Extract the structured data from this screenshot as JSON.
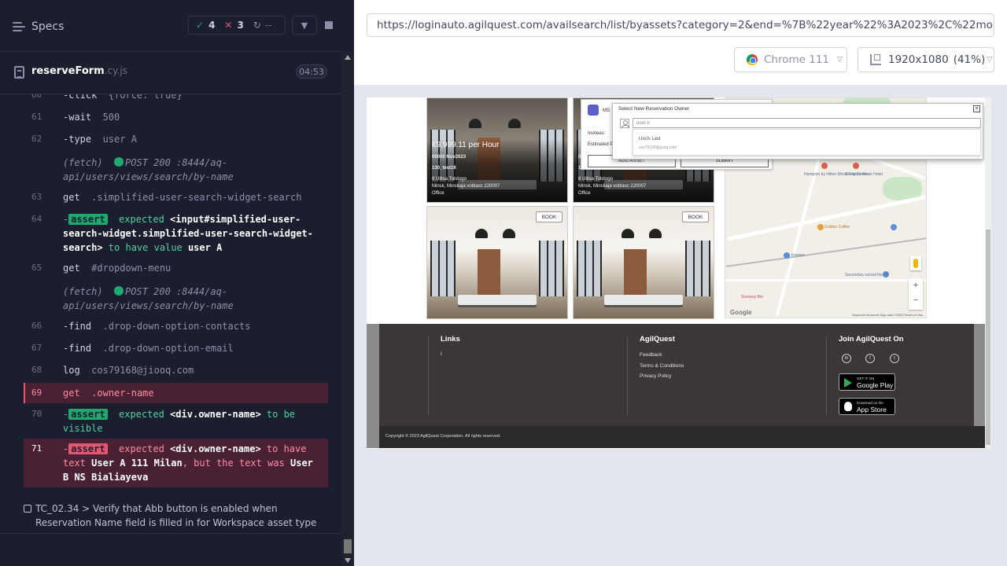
{
  "header": {
    "title": "Specs",
    "stats": {
      "passed": "4",
      "failed": "3",
      "pending": "--"
    }
  },
  "spec_file": {
    "name": "reserveForm",
    "ext": ".cy.js",
    "duration": "04:53"
  },
  "commands": [
    {
      "num": "60",
      "name": "-click",
      "message": "{force: true}"
    },
    {
      "num": "61",
      "name": "-wait",
      "message": "500"
    },
    {
      "num": "62",
      "name": "-type",
      "message": "user A"
    },
    {
      "num": "",
      "fetch_label": "(fetch)",
      "fetch_text": "POST 200 :8444/aq-api/users/views/search/by-name"
    },
    {
      "num": "63",
      "name": "get",
      "message": ".simplified-user-search-widget-search"
    },
    {
      "num": "64",
      "dash": "-",
      "badge": "assert",
      "pre": "expected ",
      "strong1": "<input#simplified-user-search-widget.simplified-user-search-widget-search>",
      "mid": " to have value ",
      "strong2": "user A"
    },
    {
      "num": "65",
      "name": "get",
      "message": "#dropdown-menu"
    },
    {
      "num": "",
      "fetch_label": "(fetch)",
      "fetch_text": "POST 200 :8444/aq-api/users/views/search/by-name"
    },
    {
      "num": "66",
      "name": "-find",
      "message": ".drop-down-option-contacts"
    },
    {
      "num": "67",
      "name": "-find",
      "message": ".drop-down-option-email"
    },
    {
      "num": "68",
      "name": "log",
      "message": "cos79168@jiooq.com"
    },
    {
      "num": "69",
      "name": "get",
      "message": ".owner-name"
    },
    {
      "num": "70",
      "dash": "-",
      "badge": "assert",
      "pre": "expected ",
      "strong1": "<div.owner-name>",
      "mid": " to be visible"
    },
    {
      "num": "71",
      "dash": "-",
      "badge": "assert",
      "pre": "expected ",
      "strong1": "<div.owner-name>",
      "mid": " to have text ",
      "strong2": "User A 111 Milan",
      "mid2": ", but the text was ",
      "strong3": "User B NS Bialiayeva"
    }
  ],
  "next_test": "TC_02.34 > Verify that Abb button is enabled when Reservation Name field is filled in for Workspace asset type",
  "browser": {
    "url": "https://loginauto.agilquest.com/availsearch/list/byassets?category=2&end=%7B%22year%22%3A2023%2C%22month%22%3",
    "name": "Chrome 111",
    "viewport": "1920x1080",
    "scale": "(41%)"
  },
  "aut": {
    "cards": [
      {
        "price": "€9,999.11 per Hour",
        "date": "00000 Nov2023",
        "name": "130_test16",
        "street": "8 Ulitsa Tolstogo",
        "city": "Minsk, Minskaja voblasc 220007",
        "type": "Office"
      },
      {
        "price": "",
        "date": "00",
        "name": "13",
        "street": "8 Ulitsa Tolstogo",
        "city": "Minsk, Minskaja voblasc 220007",
        "type": "Office"
      },
      {
        "book": "BOOK"
      },
      {
        "book": "BOOK"
      }
    ],
    "form": {
      "ms_text": "MS",
      "invitees_label": "Invitees:",
      "price_label": "Estimated Price:",
      "add_asset": "ADD ASSET",
      "submit": "SUBMIT"
    },
    "modal": {
      "title": "Select New Reservation Owner",
      "close": "×",
      "search_value": "user A",
      "option_name": "UsUs Last",
      "option_email": "cos79168@jiooq.com"
    },
    "map": {
      "labels": [
        "Hampton by Hilton Minsk City Centre",
        "Sheraton Minsk Hotel",
        "Golden Coffee",
        "Korona",
        "Secondary school No. 30",
        "Sosnovy Bor"
      ],
      "google": "Google",
      "attribution": "Keyboard shortcuts   Map data ©2023   Terms of Use",
      "zoom_in": "+",
      "zoom_out": "−"
    },
    "footer": {
      "links_title": "Links",
      "links_item": "I",
      "agilquest_title": "AgilQuest",
      "agilquest_links": [
        "Feedback",
        "Terms & Conditions",
        "Privacy Policy"
      ],
      "join_title": "Join AgilQuest On",
      "social": [
        "in",
        "f",
        "t"
      ],
      "google_play_small": "GET IT ON",
      "google_play_big": "Google Play",
      "app_store_small": "Download on the",
      "app_store_big": "App Store",
      "copyright": "Copyright © 2023 AgilQuest Corporation. All rights reserved."
    }
  },
  "colors": {
    "panel_bg": "#1b1e2e",
    "pass": "#1fa971",
    "fail": "#e45770",
    "fail_row_bg": "#4a2134",
    "aut_bg": "#e3e6ee"
  }
}
